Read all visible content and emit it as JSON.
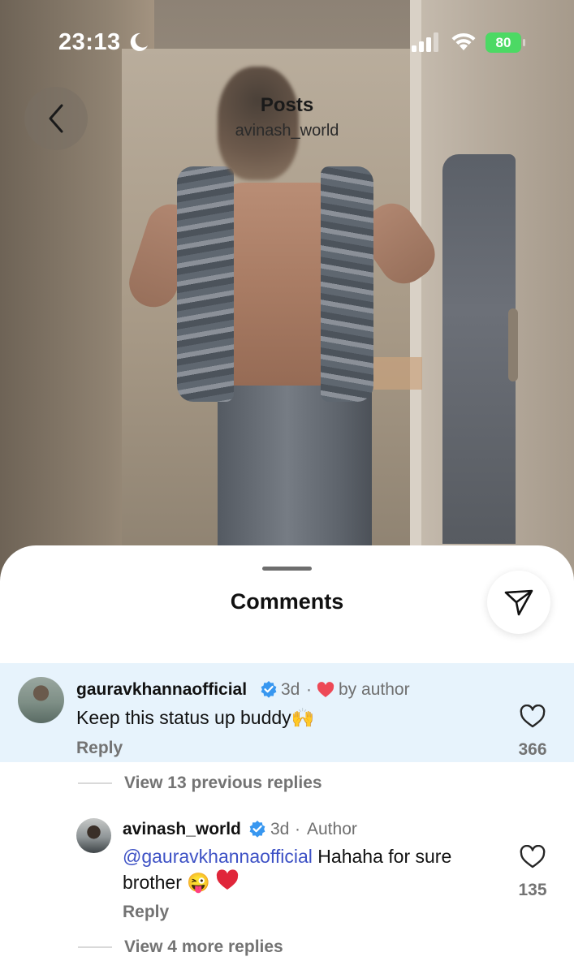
{
  "status_bar": {
    "time": "23:13",
    "battery": "80"
  },
  "header": {
    "title": "Posts",
    "username": "avinash_world"
  },
  "sheet": {
    "title": "Comments"
  },
  "comments": [
    {
      "username": "gauravkhannaofficial",
      "time": "3d",
      "liked_by": "by author",
      "text": "Keep this status up buddy",
      "emoji": "🙌",
      "reply_label": "Reply",
      "likes": "366"
    }
  ],
  "view_previous": "View 13 previous replies",
  "replies": [
    {
      "username": "avinash_world",
      "time": "3d",
      "role": "Author",
      "mention": "@gauravkhannaofficial",
      "text_line1": " Hahaha for sure",
      "text_line2": "brother",
      "emoji": "😜",
      "reply_label": "Reply",
      "likes": "135"
    }
  ],
  "view_more": "View 4 more replies",
  "colors": {
    "highlight": "#e7f3fc",
    "mention": "#3d51c5",
    "verified": "#3897f0",
    "heart": "#ed4956",
    "battery": "#4cd964"
  }
}
